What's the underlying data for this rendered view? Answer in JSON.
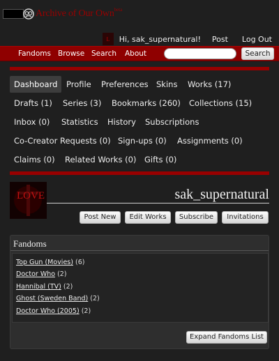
{
  "header": {
    "logo_text": "Archive of Our Own",
    "logo_tm": "beta",
    "greeting": "Hi, sak_supernatural!",
    "post_label": "Post",
    "logout_label": "Log Out"
  },
  "primary_nav": {
    "items": [
      "Fandoms",
      "Browse",
      "Search",
      "About"
    ],
    "search_placeholder": "",
    "search_button": "Search"
  },
  "dashboard_nav": {
    "active": "Dashboard",
    "rows": [
      [
        "Dashboard",
        "Profile",
        "Preferences",
        "Skins",
        "Works (17)"
      ],
      [
        "Drafts (1)",
        "Series (3)",
        "Bookmarks (260)",
        "Collections (15)"
      ],
      [
        "Inbox (0)",
        "Statistics",
        "History",
        "Subscriptions"
      ],
      [
        "Co-Creator Requests (0)",
        "Sign-ups (0)",
        "Assignments (0)"
      ],
      [
        "Claims (0)",
        "Related Works (0)",
        "Gifts (0)"
      ]
    ]
  },
  "profile": {
    "username": "sak_supernatural",
    "avatar_text": "LOVE",
    "buttons": [
      "Post New",
      "Edit Works",
      "Subscribe",
      "Invitations"
    ]
  },
  "fandoms": {
    "heading": "Fandoms",
    "items": [
      {
        "name": "Top Gun (Movies)",
        "count": "(6)"
      },
      {
        "name": "Doctor Who",
        "count": "(2)"
      },
      {
        "name": "Hannibal (TV)",
        "count": "(2)"
      },
      {
        "name": "Ghost (Sweden Band)",
        "count": "(2)"
      },
      {
        "name": "Doctor Who (2005)",
        "count": "(2)"
      }
    ],
    "expand_label": "Expand Fandoms List"
  },
  "colors": {
    "brand_red": "#990000",
    "nav_red": "#8f0000",
    "background": "#1f1f1f"
  }
}
